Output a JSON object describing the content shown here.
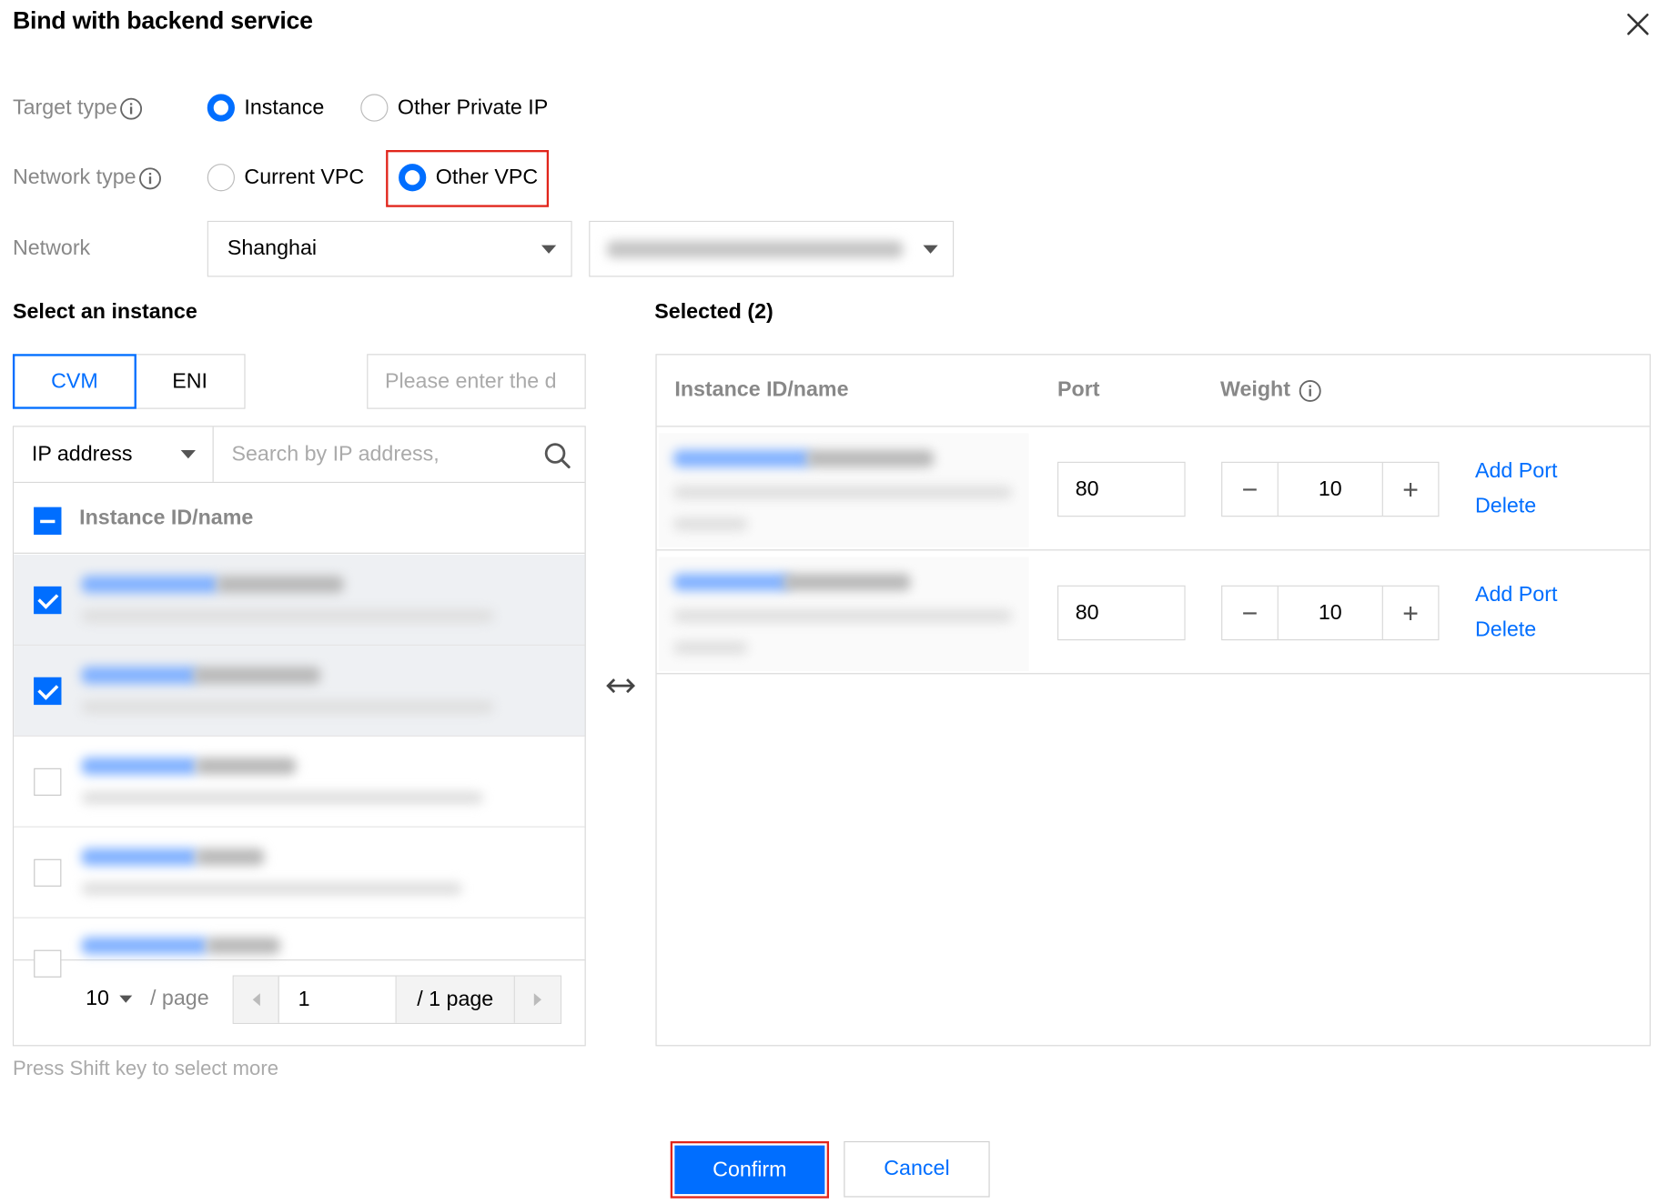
{
  "dialog": {
    "title": "Bind with backend service"
  },
  "form": {
    "target_type": {
      "label": "Target type",
      "options": [
        "Instance",
        "Other Private IP"
      ],
      "selected": "Instance"
    },
    "network_type": {
      "label": "Network type",
      "options": [
        "Current VPC",
        "Other VPC"
      ],
      "selected": "Other VPC"
    },
    "network": {
      "label": "Network",
      "region_value": "Shanghai"
    }
  },
  "select_panel": {
    "title": "Select an instance",
    "tabs": [
      "CVM",
      "ENI"
    ],
    "active_tab": "CVM",
    "search_placeholder": "Please enter the d",
    "filter_field": "IP address",
    "filter_placeholder": "Search by IP address,",
    "column_header": "Instance ID/name",
    "rows": [
      {
        "checked": true
      },
      {
        "checked": true
      },
      {
        "checked": false
      },
      {
        "checked": false
      },
      {
        "checked": false
      }
    ],
    "pagination": {
      "page_size": "10",
      "per_page_label": "/ page",
      "current_page": "1",
      "total_pages_label": "/ 1 page"
    },
    "hint": "Press Shift key to select more"
  },
  "selected_panel": {
    "title": "Selected (2)",
    "headers": {
      "instance": "Instance ID/name",
      "port": "Port",
      "weight": "Weight"
    },
    "rows": [
      {
        "port": "80",
        "weight": "10",
        "add_port": "Add Port",
        "delete": "Delete"
      },
      {
        "port": "80",
        "weight": "10",
        "add_port": "Add Port",
        "delete": "Delete"
      }
    ]
  },
  "footer": {
    "confirm": "Confirm",
    "cancel": "Cancel"
  },
  "colors": {
    "primary": "#006eff",
    "highlight": "#e1251b"
  },
  "icons": {
    "close": "close-icon",
    "info": "info-icon",
    "search": "search-icon",
    "transfer": "double-arrow-icon"
  }
}
